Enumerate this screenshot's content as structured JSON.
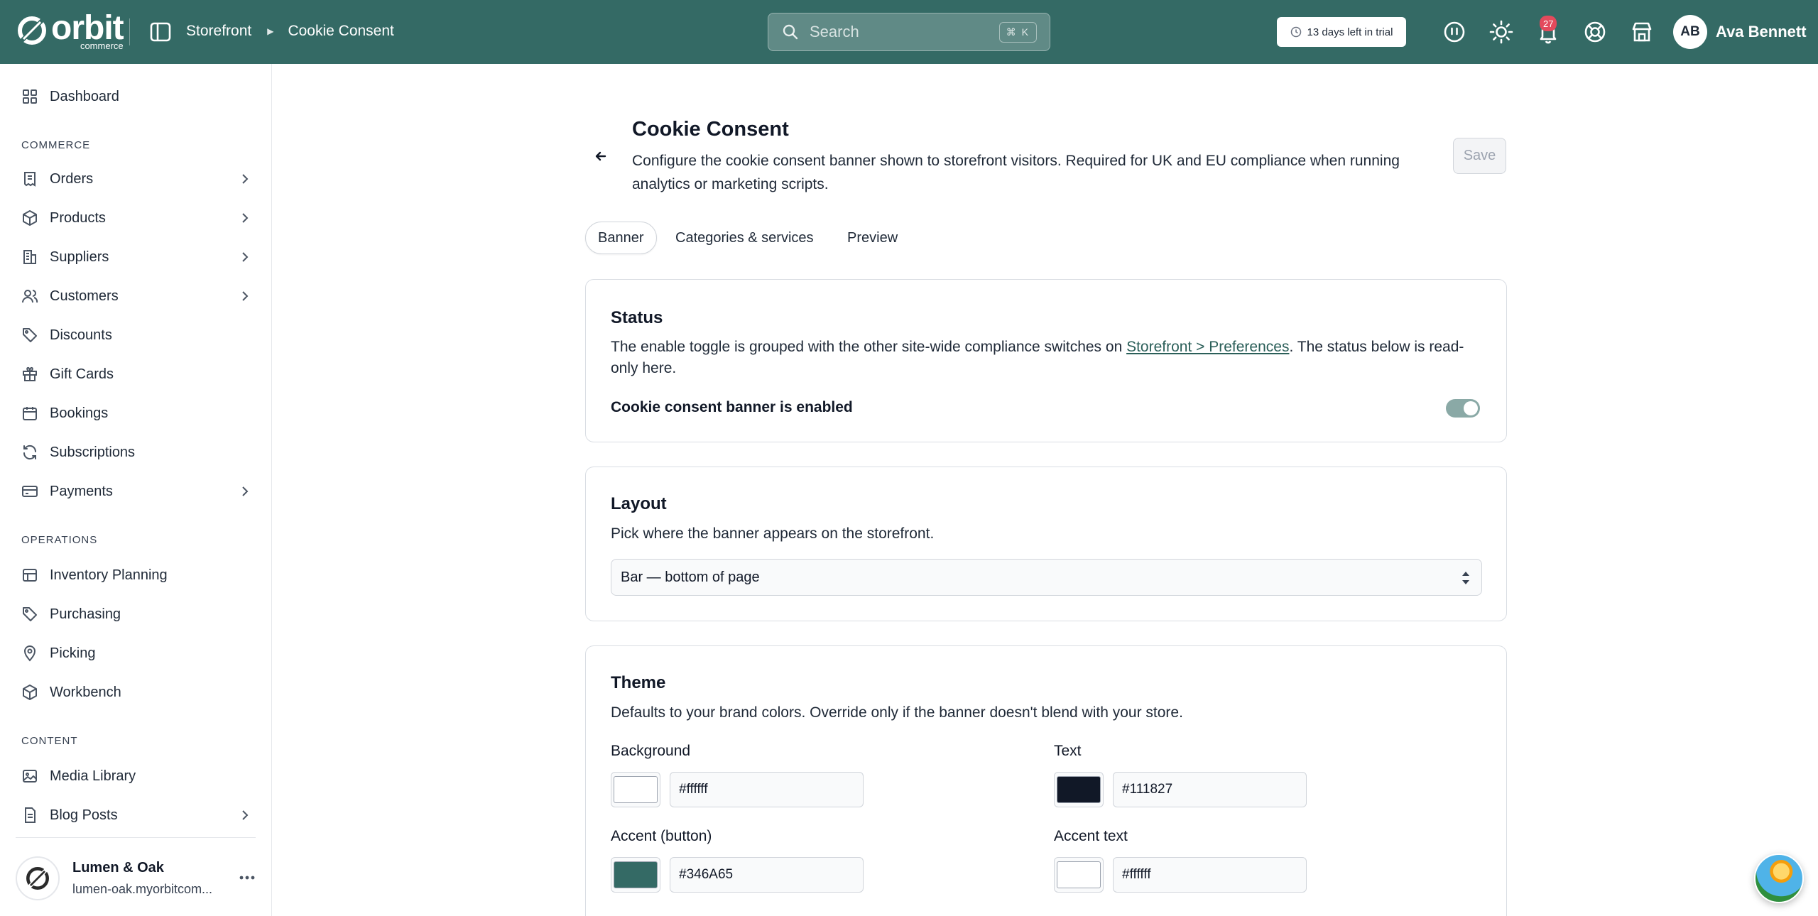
{
  "header": {
    "logo_word": "orbit",
    "logo_sub": "commerce",
    "breadcrumb": [
      "Storefront",
      "Cookie Consent"
    ],
    "search_placeholder": "Search",
    "search_shortcut": "⌘ K",
    "trial_text": "13 days left in trial",
    "notification_count": "27",
    "user_initials": "AB",
    "user_name": "Ava Bennett",
    "brand_color": "#346a65"
  },
  "sidebar": {
    "items_top": [
      {
        "label": "Dashboard",
        "icon": "dashboard-icon"
      }
    ],
    "commerce_label": "COMMERCE",
    "commerce": [
      {
        "label": "Orders",
        "icon": "orders-icon",
        "expandable": true
      },
      {
        "label": "Products",
        "icon": "box-icon",
        "expandable": true
      },
      {
        "label": "Suppliers",
        "icon": "building-icon",
        "expandable": true
      },
      {
        "label": "Customers",
        "icon": "users-icon",
        "expandable": true
      },
      {
        "label": "Discounts",
        "icon": "tag-icon",
        "expandable": false
      },
      {
        "label": "Gift Cards",
        "icon": "gift-icon",
        "expandable": false
      },
      {
        "label": "Bookings",
        "icon": "calendar-icon",
        "expandable": false
      },
      {
        "label": "Subscriptions",
        "icon": "refresh-icon",
        "expandable": false
      },
      {
        "label": "Payments",
        "icon": "card-icon",
        "expandable": true
      }
    ],
    "operations_label": "OPERATIONS",
    "operations": [
      {
        "label": "Inventory Planning",
        "icon": "inventory-icon"
      },
      {
        "label": "Purchasing",
        "icon": "tag-icon"
      },
      {
        "label": "Picking",
        "icon": "location-icon"
      },
      {
        "label": "Workbench",
        "icon": "box-icon"
      }
    ],
    "content_label": "CONTENT",
    "content": [
      {
        "label": "Media Library",
        "icon": "image-icon",
        "expandable": false
      },
      {
        "label": "Blog Posts",
        "icon": "document-icon",
        "expandable": true
      }
    ],
    "store": {
      "name": "Lumen & Oak",
      "url": "lumen-oak.myorbitcom..."
    }
  },
  "page": {
    "title": "Cookie Consent",
    "description": "Configure the cookie consent banner shown to storefront visitors. Required for UK and EU compliance when running analytics or marketing scripts.",
    "save_label": "Save",
    "tabs": [
      "Banner",
      "Categories & services",
      "Preview"
    ],
    "active_tab": "Banner"
  },
  "status_card": {
    "title": "Status",
    "text_before": "The enable toggle is grouped with the other site-wide compliance switches on ",
    "link_text": "Storefront > Preferences",
    "text_after": ". The status below is read-only here.",
    "label": "Cookie consent banner is enabled",
    "enabled": true
  },
  "layout_card": {
    "title": "Layout",
    "description": "Pick where the banner appears on the storefront.",
    "selected": "Bar — bottom of page"
  },
  "theme_card": {
    "title": "Theme",
    "description": "Defaults to your brand colors. Override only if the banner doesn't blend with your store.",
    "fields": [
      {
        "label": "Background",
        "value": "#ffffff"
      },
      {
        "label": "Text",
        "value": "#111827"
      },
      {
        "label": "Accent (button)",
        "value": "#346A65"
      },
      {
        "label": "Accent text",
        "value": "#ffffff"
      }
    ]
  }
}
